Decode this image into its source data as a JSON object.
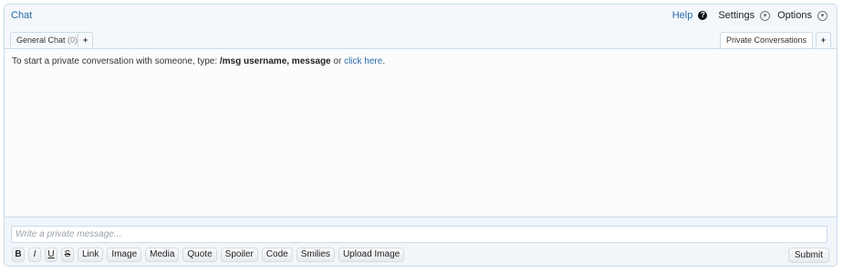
{
  "header": {
    "title": "Chat",
    "help_label": "Help",
    "help_icon": "?",
    "settings_label": "Settings",
    "options_label": "Options",
    "chevron": "▾"
  },
  "tabs": {
    "general": {
      "label": "General Chat",
      "count": "(0)"
    },
    "add_left": "+",
    "private": {
      "label": "Private Conversations"
    },
    "add_right": "+"
  },
  "content": {
    "intro_prefix": "To start a private conversation with someone, type: ",
    "intro_command": "/msg username, message",
    "intro_middle": " or ",
    "intro_link": "click here",
    "intro_suffix": "."
  },
  "composer": {
    "placeholder": "Write a private message...",
    "buttons": [
      "B",
      "I",
      "U",
      "S",
      "Link",
      "Image",
      "Media",
      "Quote",
      "Spoiler",
      "Code",
      "Smilies",
      "Upload Image"
    ],
    "submit_label": "Submit"
  }
}
